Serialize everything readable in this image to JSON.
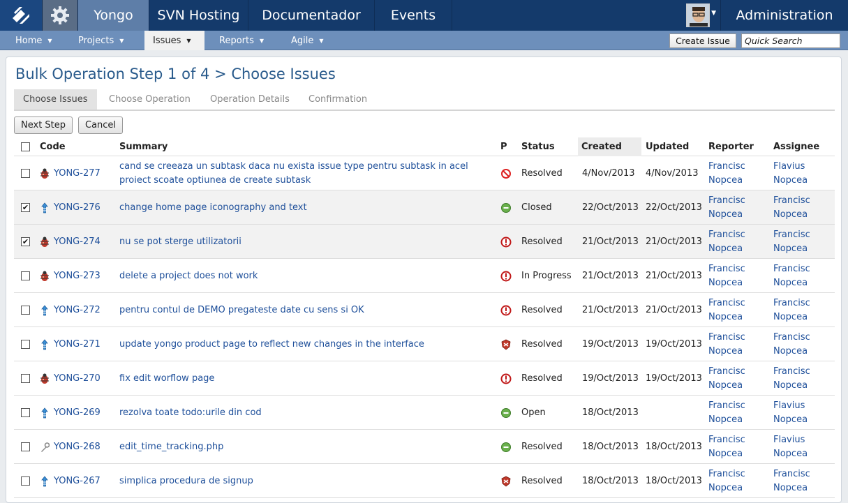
{
  "topbar": {
    "tabs": [
      "Yongo",
      "SVN Hosting",
      "Documentador",
      "Events"
    ],
    "active_tab": "Yongo",
    "admin_label": "Administration"
  },
  "subnav": {
    "items": [
      "Home",
      "Projects",
      "Issues",
      "Reports",
      "Agile"
    ],
    "active": "Issues",
    "create_issue": "Create Issue",
    "quick_search": "Quick Search"
  },
  "page": {
    "title": "Bulk Operation Step 1 of 4 > Choose Issues",
    "steps": [
      "Choose Issues",
      "Choose Operation",
      "Operation Details",
      "Confirmation"
    ],
    "buttons": {
      "next": "Next Step",
      "cancel": "Cancel"
    }
  },
  "table": {
    "headers": {
      "code": "Code",
      "summary": "Summary",
      "p": "P",
      "status": "Status",
      "created": "Created",
      "updated": "Updated",
      "reporter": "Reporter",
      "assignee": "Assignee"
    },
    "rows": [
      {
        "checked": false,
        "type": "bug-icon",
        "code": "YONG-277",
        "summary": [
          "cand se creeaza un subtask daca nu exista issue type pentru subtask in acel",
          "proiect scoate optiunea de create subtask"
        ],
        "priority": "blocked-icon",
        "status": "Resolved",
        "created": "4/Nov/2013",
        "updated": "4/Nov/2013",
        "reporter": [
          "Francisc",
          "Nopcea"
        ],
        "assignee": [
          "Flavius",
          "Nopcea"
        ]
      },
      {
        "checked": true,
        "type": "improvement-icon",
        "code": "YONG-276",
        "summary": [
          "change home page iconography and text"
        ],
        "priority": "minor-icon",
        "status": "Closed",
        "created": "22/Oct/2013",
        "updated": "22/Oct/2013",
        "reporter": [
          "Francisc",
          "Nopcea"
        ],
        "assignee": [
          "Francisc",
          "Nopcea"
        ]
      },
      {
        "checked": true,
        "type": "bug-icon",
        "code": "YONG-274",
        "summary": [
          "nu se pot sterge utilizatorii"
        ],
        "priority": "critical-icon",
        "status": "Resolved",
        "created": "21/Oct/2013",
        "updated": "21/Oct/2013",
        "reporter": [
          "Francisc",
          "Nopcea"
        ],
        "assignee": [
          "Francisc",
          "Nopcea"
        ]
      },
      {
        "checked": false,
        "type": "bug-icon",
        "code": "YONG-273",
        "summary": [
          "delete a project does not work"
        ],
        "priority": "critical-icon",
        "status": "In Progress",
        "created": "21/Oct/2013",
        "updated": "21/Oct/2013",
        "reporter": [
          "Francisc",
          "Nopcea"
        ],
        "assignee": [
          "Francisc",
          "Nopcea"
        ]
      },
      {
        "checked": false,
        "type": "improvement-icon",
        "code": "YONG-272",
        "summary": [
          "pentru contul de DEMO pregateste date cu sens si OK"
        ],
        "priority": "critical-icon",
        "status": "Resolved",
        "created": "21/Oct/2013",
        "updated": "21/Oct/2013",
        "reporter": [
          "Francisc",
          "Nopcea"
        ],
        "assignee": [
          "Francisc",
          "Nopcea"
        ]
      },
      {
        "checked": false,
        "type": "improvement-icon",
        "code": "YONG-271",
        "summary": [
          "update yongo product page to reflect new changes in the interface"
        ],
        "priority": "major-icon",
        "status": "Resolved",
        "created": "19/Oct/2013",
        "updated": "19/Oct/2013",
        "reporter": [
          "Francisc",
          "Nopcea"
        ],
        "assignee": [
          "Francisc",
          "Nopcea"
        ]
      },
      {
        "checked": false,
        "type": "bug-icon",
        "code": "YONG-270",
        "summary": [
          "fix edit worflow page"
        ],
        "priority": "critical-icon",
        "status": "Resolved",
        "created": "19/Oct/2013",
        "updated": "19/Oct/2013",
        "reporter": [
          "Francisc",
          "Nopcea"
        ],
        "assignee": [
          "Francisc",
          "Nopcea"
        ]
      },
      {
        "checked": false,
        "type": "improvement-icon",
        "code": "YONG-269",
        "summary": [
          "rezolva toate todo:urile din cod"
        ],
        "priority": "minor-icon",
        "status": "Open",
        "created": "18/Oct/2013",
        "updated": "",
        "reporter": [
          "Francisc",
          "Nopcea"
        ],
        "assignee": [
          "Flavius",
          "Nopcea"
        ]
      },
      {
        "checked": false,
        "type": "task-icon",
        "code": "YONG-268",
        "summary": [
          "edit_time_tracking.php"
        ],
        "priority": "minor-icon",
        "status": "Resolved",
        "created": "18/Oct/2013",
        "updated": "18/Oct/2013",
        "reporter": [
          "Francisc",
          "Nopcea"
        ],
        "assignee": [
          "Flavius",
          "Nopcea"
        ]
      },
      {
        "checked": false,
        "type": "improvement-icon",
        "code": "YONG-267",
        "summary": [
          "simplica procedura de signup"
        ],
        "priority": "major-icon",
        "status": "Resolved",
        "created": "18/Oct/2013",
        "updated": "18/Oct/2013",
        "reporter": [
          "Francisc",
          "Nopcea"
        ],
        "assignee": [
          "Francisc",
          "Nopcea"
        ]
      }
    ]
  }
}
